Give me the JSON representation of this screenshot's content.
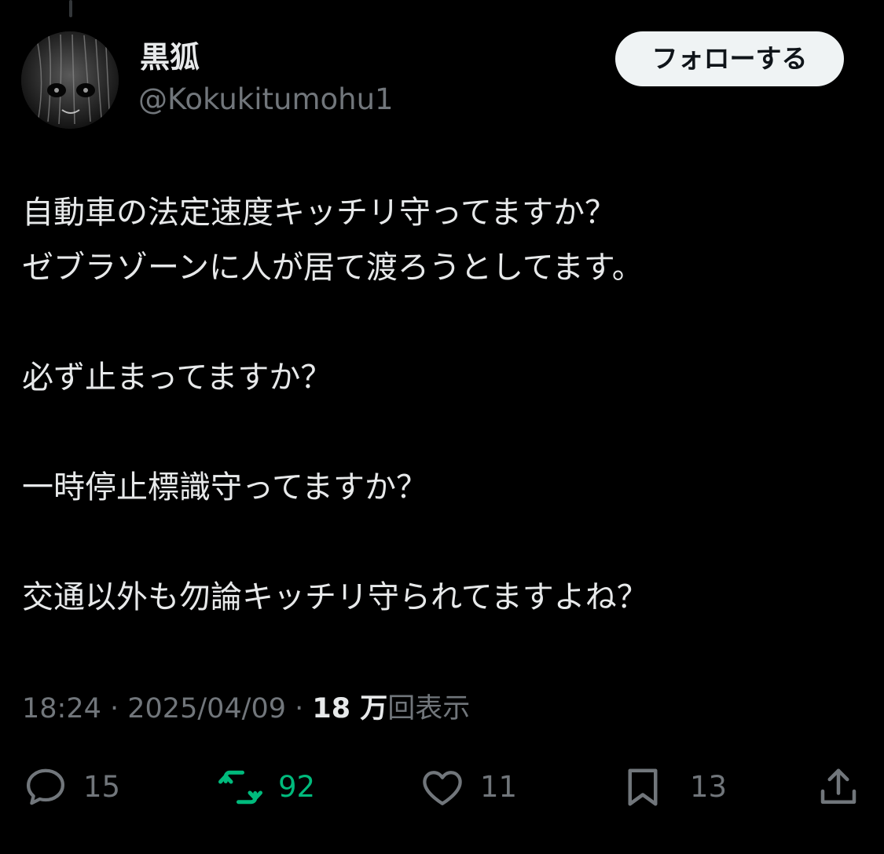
{
  "author": {
    "display_name": "黒狐",
    "handle": "@Kokukitumohu1"
  },
  "follow_button": {
    "label": "フォローする"
  },
  "tweet": {
    "lines": [
      "自動車の法定速度キッチリ守ってますか？",
      "ゼブラゾーンに人が居て渡ろうとしてます。",
      "",
      "必ず止まってますか？",
      "",
      "一時停止標識守ってますか？",
      "",
      "交通以外も勿論キッチリ守られてますよね？"
    ]
  },
  "meta": {
    "time": "18:24",
    "separator": " · ",
    "date": "2025/04/09",
    "views_count": "18 万",
    "views_label": "回表示"
  },
  "actions": {
    "reply": {
      "count": "15",
      "icon": "reply-icon"
    },
    "retweet": {
      "count": "92",
      "icon": "retweet-icon"
    },
    "like": {
      "count": "11",
      "icon": "heart-icon"
    },
    "bookmark": {
      "count": "13",
      "icon": "bookmark-icon"
    },
    "share": {
      "icon": "share-icon"
    }
  },
  "colors": {
    "background": "#000000",
    "text_primary": "#e7e9ea",
    "text_secondary": "#71767b",
    "retweet_active": "#00ba7c",
    "follow_button_bg": "#eff3f4"
  }
}
